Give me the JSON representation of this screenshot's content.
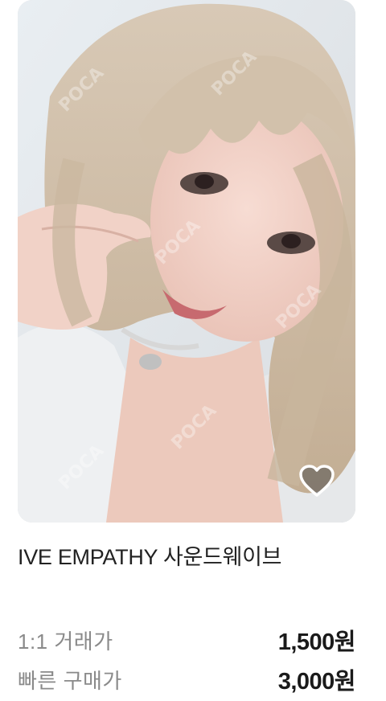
{
  "product": {
    "title": "IVE EMPATHY 사운드웨이브",
    "image_alt": "Photocard photo",
    "watermark_text": "POCA"
  },
  "heart_icon": "heart-outline-icon",
  "prices": [
    {
      "label": "1:1 거래가",
      "value": "1,500원"
    },
    {
      "label": "빠른 구매가",
      "value": "3,000원"
    }
  ]
}
